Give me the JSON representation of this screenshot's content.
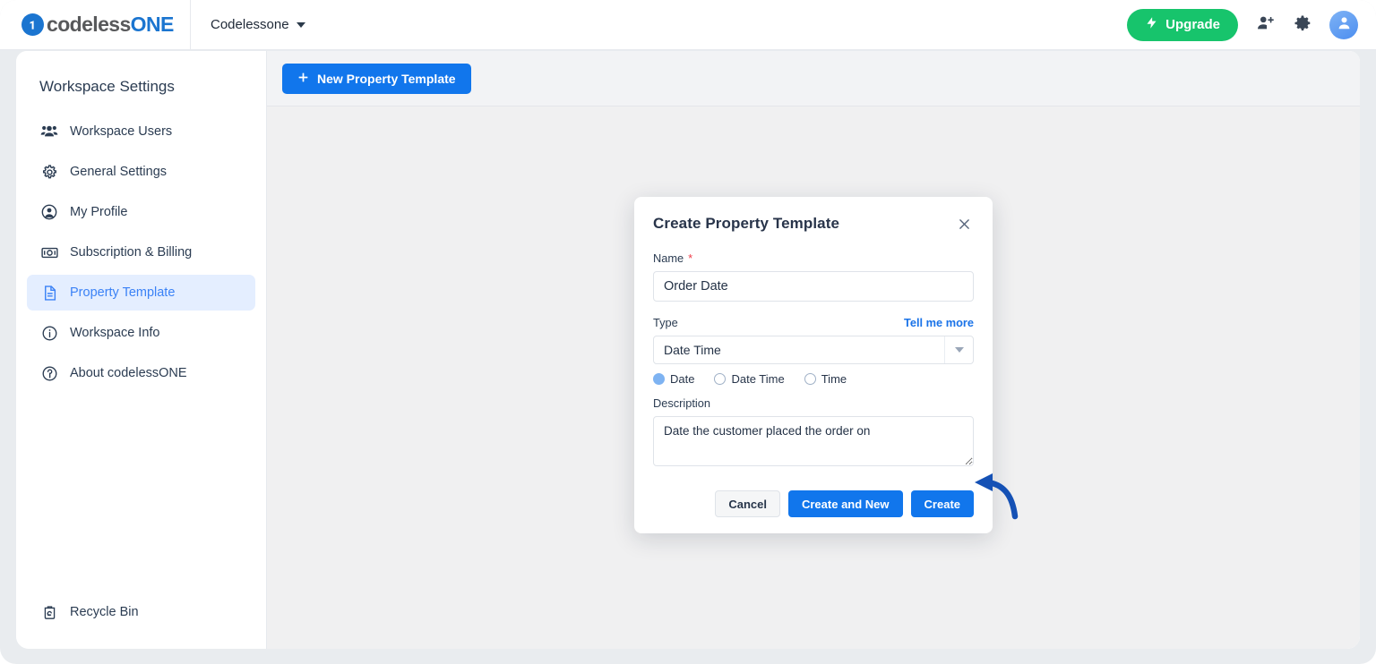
{
  "topbar": {
    "logo_text_a": "codeless",
    "logo_text_b": "ONE",
    "logo_icon": "codeless-one-logo",
    "workspace_name": "Codelessone",
    "workspace_caret_icon": "chevron-down-icon",
    "upgrade_label": "Upgrade",
    "upgrade_icon": "lightning-bolt-icon",
    "upgrade_color": "#17c46c",
    "invite_icon": "add-user-icon",
    "settings_icon": "gear-icon",
    "avatar_icon": "user-avatar-icon"
  },
  "sidebar": {
    "title": "Workspace Settings",
    "items": [
      {
        "label": "Workspace Users",
        "icon": "users-group-icon",
        "active": false
      },
      {
        "label": "General Settings",
        "icon": "gear-icon",
        "active": false
      },
      {
        "label": "My Profile",
        "icon": "user-circle-icon",
        "active": false
      },
      {
        "label": "Subscription & Billing",
        "icon": "banknote-icon",
        "active": false
      },
      {
        "label": "Property Template",
        "icon": "document-icon",
        "active": true
      },
      {
        "label": "Workspace Info",
        "icon": "info-circle-icon",
        "active": false
      },
      {
        "label": "About codelessONE",
        "icon": "about-circle-icon",
        "active": false
      }
    ],
    "footer_item": {
      "label": "Recycle Bin",
      "icon": "recycle-bin-icon"
    },
    "active_color": "#3b82f6",
    "active_bg": "#e4eeff"
  },
  "toolbar": {
    "new_template_label": "New Property Template",
    "new_template_icon": "plus-icon",
    "primary_color": "#1176ec"
  },
  "modal": {
    "title": "Create Property Template",
    "close_icon": "close-icon",
    "name": {
      "label": "Name",
      "required_marker": "*",
      "value": "Order Date",
      "placeholder": ""
    },
    "type": {
      "label": "Type",
      "help_link": "Tell me more",
      "selected": "Date Time",
      "dropdown_icon": "chevron-down-icon",
      "options": [
        {
          "label": "Date",
          "checked": true
        },
        {
          "label": "Date Time",
          "checked": false
        },
        {
          "label": "Time",
          "checked": false
        }
      ]
    },
    "description": {
      "label": "Description",
      "value": "Date the customer placed the order on",
      "placeholder": ""
    },
    "buttons": {
      "cancel": "Cancel",
      "create_and_new": "Create and New",
      "create": "Create"
    }
  },
  "annotation": {
    "arrow_icon": "curved-arrow-pointing-left",
    "color": "#1551b5",
    "points_at": "Create"
  }
}
